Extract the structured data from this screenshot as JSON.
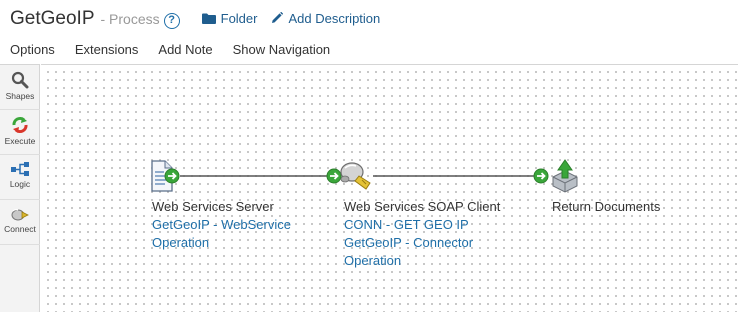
{
  "header": {
    "process_name": "GetGeoIP",
    "process_type": "- Process",
    "help_glyph": "?",
    "folder_label": "Folder",
    "add_description_label": "Add Description"
  },
  "menu": {
    "items": [
      "Options",
      "Extensions",
      "Add Note",
      "Show Navigation"
    ]
  },
  "palette": {
    "items": [
      {
        "label": "Shapes",
        "icon": "magnifier-icon"
      },
      {
        "label": "Execute",
        "icon": "execute-icon"
      },
      {
        "label": "Logic",
        "icon": "logic-icon"
      },
      {
        "label": "Connect",
        "icon": "connect-icon"
      }
    ]
  },
  "canvas": {
    "shapes": [
      {
        "title": "Web Services Server",
        "lines": [
          "GetGeoIP - WebService",
          "Operation"
        ],
        "icon": "document-arrow-icon"
      },
      {
        "title": "Web Services SOAP Client",
        "lines": [
          "CONN - GET GEO IP",
          "GetGeoIP - Connector",
          "Operation"
        ],
        "icon": "plug-connector-icon"
      },
      {
        "title": "Return Documents",
        "lines": [],
        "icon": "return-documents-icon"
      }
    ]
  },
  "colors": {
    "link": "#1f6fa8",
    "connector_green": "#3aa63a",
    "canvas_dot": "#b9b9b9"
  }
}
